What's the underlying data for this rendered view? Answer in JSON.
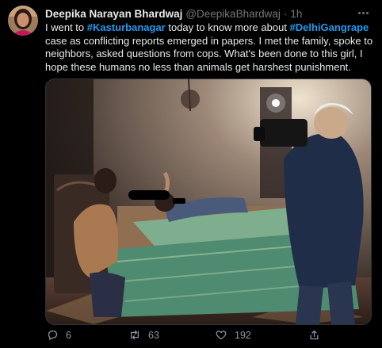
{
  "author": {
    "display_name": "Deepika Narayan Bhardwaj",
    "handle": "@DeepikaBhardwaj",
    "separator": "·",
    "time": "1h"
  },
  "tweet": {
    "segments": [
      "I went to ",
      "#Kasturbanagar",
      " today to know more about ",
      "#DelhiGangrape",
      " case as conflicting reports emerged in papers. I met the family, spoke to neighbors, asked questions from cops. What's been done to this girl, I hope these humans no less than animals get harshest punishment."
    ]
  },
  "actions": {
    "replies": "6",
    "retweets": "63",
    "likes": "192"
  },
  "icons": {
    "more": "more-horizontal-icon",
    "reply": "reply-icon",
    "retweet": "retweet-icon",
    "like": "heart-icon",
    "share": "share-icon"
  },
  "colors": {
    "background": "#000000",
    "text": "#e7e9ea",
    "muted": "#71767b",
    "link": "#1d9bf0"
  }
}
